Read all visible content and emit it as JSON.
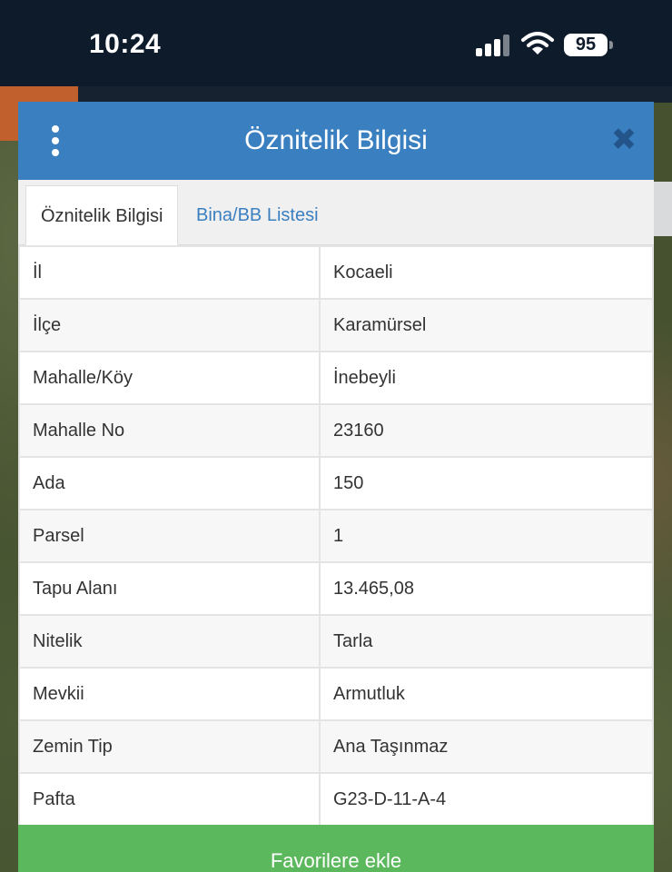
{
  "status_bar": {
    "time": "10:24",
    "battery": "95",
    "icons": [
      "signal-icon",
      "wifi-icon",
      "battery-icon"
    ]
  },
  "dialog": {
    "title": "Öznitelik Bilgisi",
    "menu_icon": "more-vertical-icon",
    "close_icon": "close-icon",
    "tabs": [
      {
        "label": "Öznitelik Bilgisi",
        "active": true
      },
      {
        "label": "Bina/BB Listesi",
        "active": false
      }
    ],
    "rows": [
      {
        "key": "İl",
        "value": "Kocaeli"
      },
      {
        "key": "İlçe",
        "value": "Karamürsel"
      },
      {
        "key": "Mahalle/Köy",
        "value": "İnebeyli"
      },
      {
        "key": "Mahalle No",
        "value": "23160"
      },
      {
        "key": "Ada",
        "value": "150"
      },
      {
        "key": "Parsel",
        "value": "1"
      },
      {
        "key": "Tapu Alanı",
        "value": "13.465,08"
      },
      {
        "key": "Nitelik",
        "value": "Tarla"
      },
      {
        "key": "Mevkii",
        "value": "Armutluk"
      },
      {
        "key": "Zemin Tip",
        "value": "Ana Taşınmaz"
      },
      {
        "key": "Pafta",
        "value": "G23-D-11-A-4"
      }
    ],
    "favorite_button": "Favorilere ekle"
  },
  "colors": {
    "header_blue": "#3a7fc0",
    "button_green": "#5cb85c",
    "status_bar_bg": "#0e1b2b"
  }
}
